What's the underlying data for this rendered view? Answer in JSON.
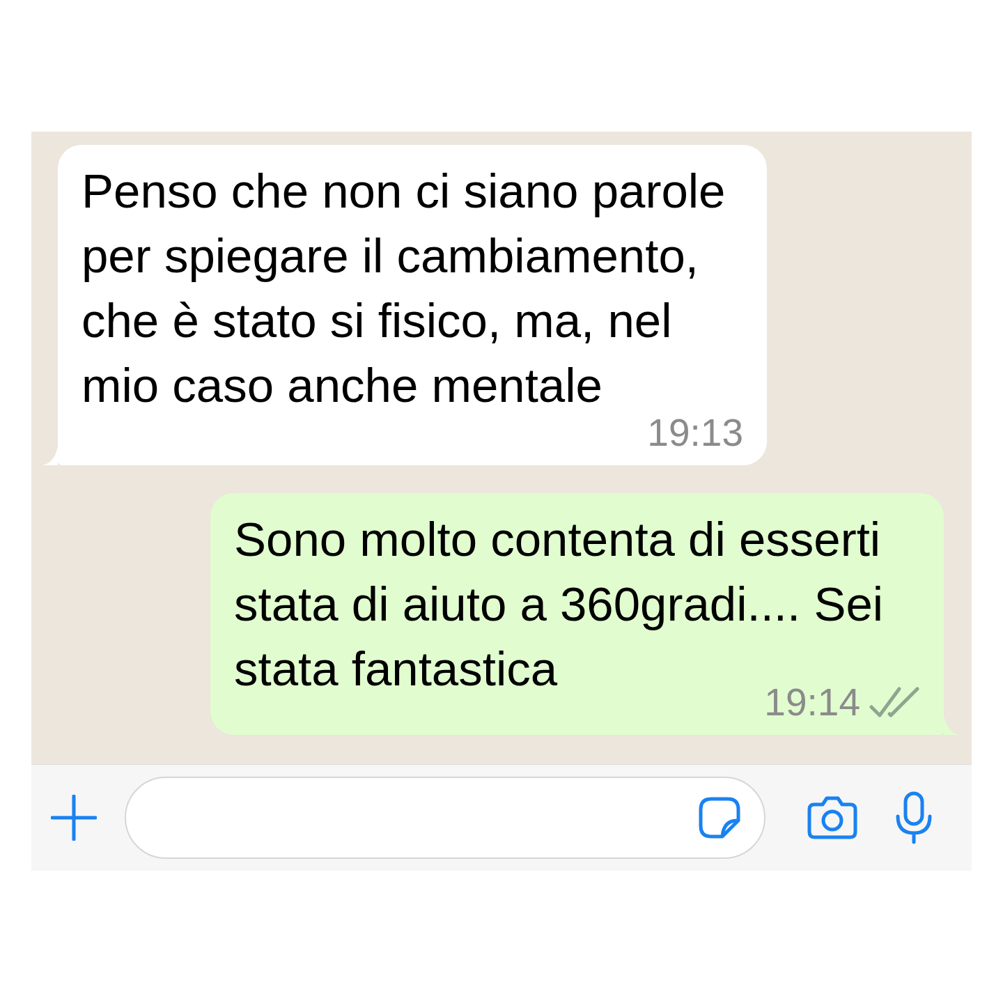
{
  "messages": [
    {
      "kind": "incoming",
      "text": "Penso che non ci siano parole per spiegare il cambiamento, che è stato si fisico, ma, nel mio caso anche mentale",
      "time": "19:13"
    },
    {
      "kind": "outgoing",
      "text": "Sono molto contenta di esserti stata di aiuto a 360gradi.... Sei stata fantastica",
      "time": "19:14",
      "read": false
    }
  ]
}
